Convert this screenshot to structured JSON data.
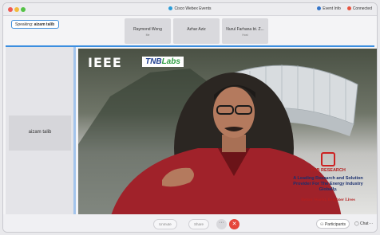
{
  "titlebar": {
    "app_title": "Cisco Webex Events",
    "event_info": "Event Info",
    "status": "Connected"
  },
  "speaking": {
    "label": "Speaking:",
    "name": "aizam talib"
  },
  "thumbnails": [
    {
      "name": "Raymond Wong",
      "sub": "Me"
    },
    {
      "name": "Azhar Aziz",
      "sub": ""
    },
    {
      "name": "Nurul Farhana bt. Z...",
      "sub": "Host"
    }
  ],
  "participant_tile": {
    "name": "aizam talib"
  },
  "video": {
    "ieee": "IEEE",
    "tnb": "TNB",
    "labs": "Labs",
    "research_title": "TNB RESEARCH",
    "research_line": "A Leading Research and Solution Provider For The Energy Industry Globally.",
    "slogan": "Better World, Brighter Lives"
  },
  "controls": {
    "unmute": "Unmute",
    "share": "Share",
    "more": "···",
    "leave": "✕",
    "participants": "Participants",
    "chat": "Chat",
    "overflow": "···"
  },
  "colors": {
    "accent": "#3b8ee0",
    "leave": "#e5463b",
    "brand_red": "#b41f1f",
    "brand_blue": "#1a2f6e"
  }
}
